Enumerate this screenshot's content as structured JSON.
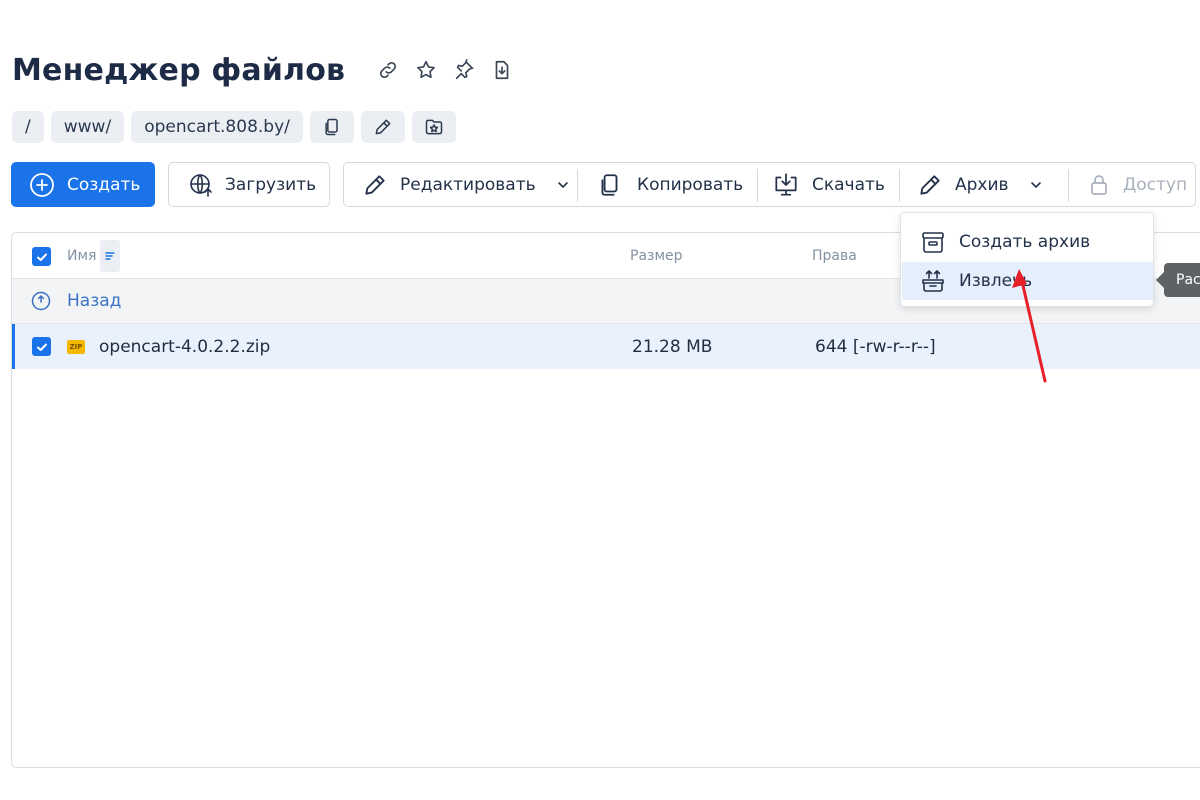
{
  "header": {
    "title": "Менеджер файлов",
    "icons": [
      "link-icon",
      "star-icon",
      "pin-icon",
      "download-doc-icon"
    ]
  },
  "breadcrumb": {
    "items": [
      "/",
      "www/",
      "opencart.808.by/"
    ],
    "buttons": [
      "copy-icon",
      "pencil-icon",
      "bookmark-star-icon"
    ]
  },
  "toolbar": {
    "create_label": "Создать",
    "upload_label": "Загрузить",
    "edit_label": "Редактировать",
    "copy_label": "Копировать",
    "download_label": "Скачать",
    "archive_label": "Архив",
    "access_label": "Доступ"
  },
  "table": {
    "columns": [
      "Имя",
      "Размер",
      "Права"
    ],
    "back_label": "Назад",
    "rows": [
      {
        "name": "opencart-4.0.2.2.zip",
        "size": "21.28 MB",
        "perms": "644 [-rw-r--r--]",
        "type_badge": "ZIP",
        "selected": true
      }
    ]
  },
  "archive_menu": {
    "items": [
      {
        "label": "Создать архив",
        "icon": "archive-box-icon"
      },
      {
        "label": "Извлечь",
        "icon": "extract-icon",
        "highlighted": true
      }
    ]
  },
  "tooltip": {
    "text": "Рас"
  },
  "colors": {
    "accent": "#1a73e8",
    "selected_row": "#e9f1fd",
    "annotation": "#e8202a"
  }
}
